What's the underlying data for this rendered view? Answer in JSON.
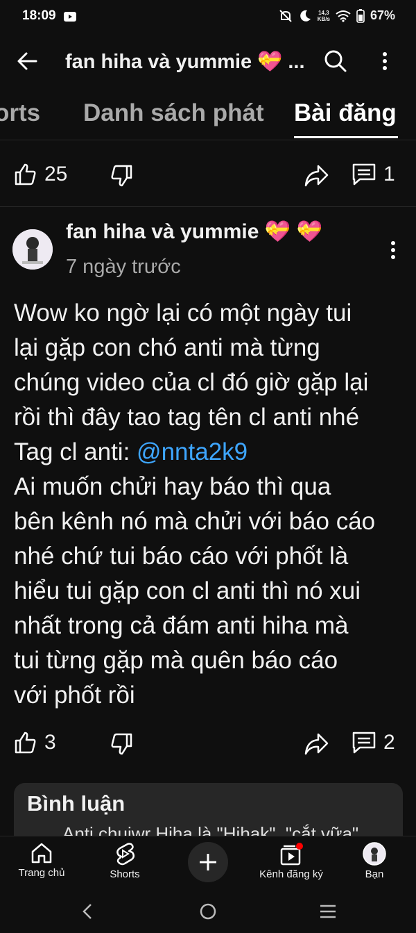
{
  "status_bar": {
    "time": "18:09",
    "net_speed_value": "14,3",
    "net_speed_unit": "KB/s",
    "battery": "67%"
  },
  "header": {
    "channel_title": "fan hiha và yummie 💝 ..."
  },
  "tabs": [
    {
      "label": "Shorts",
      "visible_label": "orts"
    },
    {
      "label": "Danh sách phát"
    },
    {
      "label": "Bài đăng",
      "selected": true
    }
  ],
  "prev_post_actions": {
    "likes": "25",
    "comments": "1"
  },
  "post": {
    "author": "fan hiha và yummie 💝 💝",
    "time_ago": "7 ngày trước",
    "body_line_1": "Wow ko ngờ lại có một ngày tui",
    "body_line_2": "lại gặp con chó anti mà từng",
    "body_line_3": "chúng video của cl đó giờ gặp lại",
    "body_line_4": "rồi thì đây tao tag tên cl anti nhé",
    "body_tag_label": "Tag cl anti: ",
    "mention": "@nnta2k9",
    "body_line_6": "Ai muốn chửi hay báo thì qua",
    "body_line_7": "bên kênh nó mà chửi với báo cáo",
    "body_line_8": "nhé chứ tui báo cáo với phốt là",
    "body_line_9": "hiểu tui gặp con cl anti thì nó xui",
    "body_line_10": "nhất trong cả đám anti hiha mà",
    "body_line_11": "tui từng gặp mà quên báo cáo",
    "body_line_12": "với phốt rồi",
    "likes": "3",
    "comments": "2"
  },
  "comments": {
    "title": "Bình luận",
    "preview": "Anti chuiwr Hiha là \"Hihak\", \"cắt vữa\""
  },
  "bottom_nav": {
    "home": "Trang chủ",
    "shorts": "Shorts",
    "subscriptions": "Kênh đăng ký",
    "you": "Bạn"
  },
  "colors": {
    "background": "#0f0f0f",
    "mention": "#3ea6ff",
    "notification_dot": "#ff0000"
  },
  "icons": [
    "back-arrow-icon",
    "search-icon",
    "more-vert-icon",
    "thumb-up-icon",
    "thumb-down-icon",
    "share-icon",
    "comment-icon",
    "home-icon",
    "shorts-icon",
    "add-icon",
    "subscriptions-icon"
  ]
}
